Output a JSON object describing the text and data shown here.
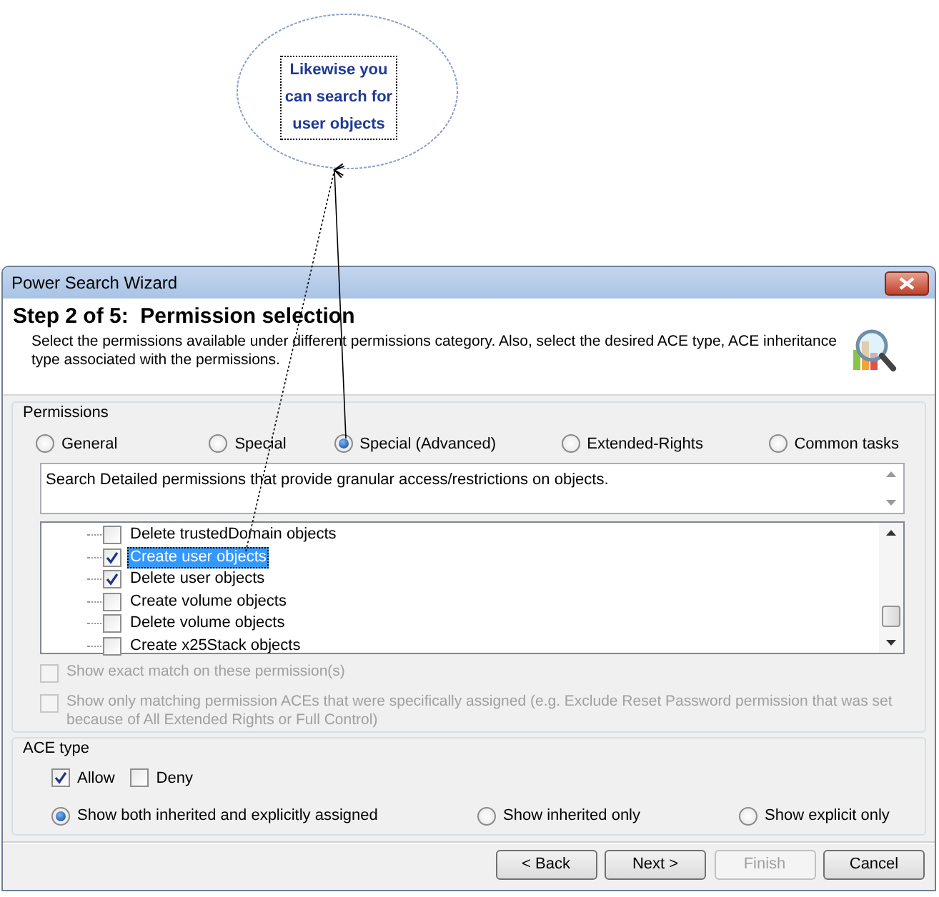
{
  "callout": {
    "text": "Likewise you can search for user objects"
  },
  "window": {
    "title": "Power Search Wizard"
  },
  "header": {
    "step": "Step 2 of 5:  Permission selection",
    "description": "Select the permissions available under different permissions category. Also, select the desired ACE type, ACE inheritance type associated with the permissions."
  },
  "permissions": {
    "label": "Permissions",
    "categories": [
      {
        "label": "General",
        "selected": false
      },
      {
        "label": "Special",
        "selected": false
      },
      {
        "label": "Special (Advanced)",
        "selected": true
      },
      {
        "label": "Extended-Rights",
        "selected": false
      },
      {
        "label": "Common tasks",
        "selected": false
      }
    ],
    "category_description": "Search Detailed permissions that provide granular access/restrictions on objects.",
    "items": [
      {
        "label": "Delete trustedDomain objects",
        "checked": false,
        "selected": false
      },
      {
        "label": "Create user objects",
        "checked": true,
        "selected": true
      },
      {
        "label": "Delete user objects",
        "checked": true,
        "selected": false
      },
      {
        "label": "Create volume objects",
        "checked": false,
        "selected": false
      },
      {
        "label": "Delete volume objects",
        "checked": false,
        "selected": false
      },
      {
        "label": "Create x25Stack objects",
        "checked": false,
        "selected": false
      }
    ],
    "options": [
      {
        "label": "Show exact match on these permission(s)",
        "checked": false,
        "disabled": true
      },
      {
        "label": "Show only matching permission ACEs that were specifically assigned (e.g. Exclude Reset Password permission that was set because of All Extended Rights or Full Control)",
        "checked": false,
        "disabled": true
      }
    ]
  },
  "ace_type": {
    "label": "ACE type",
    "types": [
      {
        "label": "Allow",
        "checked": true
      },
      {
        "label": "Deny",
        "checked": false
      }
    ],
    "inheritance": [
      {
        "label": "Show both inherited and explicitly assigned",
        "selected": true
      },
      {
        "label": "Show inherited only",
        "selected": false
      },
      {
        "label": "Show explicit only",
        "selected": false
      }
    ]
  },
  "buttons": [
    {
      "label": "< Back",
      "disabled": false
    },
    {
      "label": "Next >",
      "disabled": false
    },
    {
      "label": "Finish",
      "disabled": true
    },
    {
      "label": "Cancel",
      "disabled": false
    }
  ]
}
